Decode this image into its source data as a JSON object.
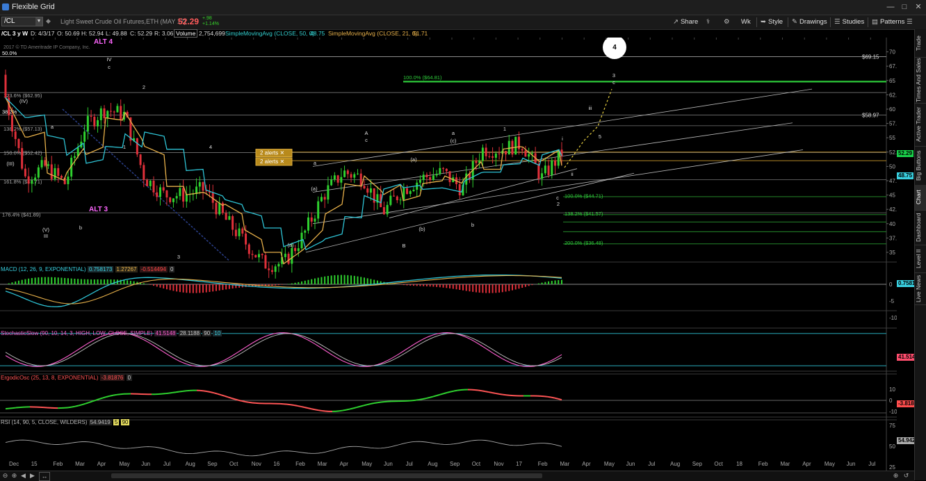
{
  "window": {
    "title": "Flexible Grid"
  },
  "toolbar": {
    "symbol": "/CL",
    "description": "Light Sweet Crude Oil Futures,ETH (MAY 17)",
    "last_price": "52.29",
    "change": "+.98",
    "change_pct": "+1.14%",
    "buttons": [
      "Share",
      "Wk",
      "Style",
      "Drawings",
      "Studies",
      "Patterns"
    ]
  },
  "info": {
    "symbol_period": "/CL 3 y W",
    "date": "D: 4/3/17",
    "open": "O: 50.69",
    "high": "H: 52.94",
    "low": "L: 49.88",
    "close": "C: 52.29",
    "range": "R: 3.06",
    "volume_label": "Volume",
    "volume": "2,754,699",
    "sma50_label": "SimpleMovingAvg (CLOSE, 50, 0)",
    "sma50_value": "48.75",
    "sma21_label": "SimpleMovingAvg (CLOSE, 21, 0)",
    "sma21_value": "51.71",
    "copyright": "2017 © TD Ameritrade IP Company, Inc."
  },
  "price_axis": [
    "70",
    "67.5",
    "65",
    "62.5",
    "60",
    "57.5",
    "55",
    "52.5",
    "50",
    "47.5",
    "45",
    "42.5",
    "40",
    "37.5",
    "35"
  ],
  "price_flags": {
    "last": "52.29",
    "sma50": "48.75",
    "hi_level": "$69.15",
    "level2": "$58.97"
  },
  "fib_labels": {
    "left": [
      "50.0%",
      "123.6% ($62.95)",
      "38.2%",
      "138.2% ($57.13)",
      "150.0% ($52.42)",
      "161.8% ($47.71)",
      "176.4% ($41.89)"
    ],
    "right": [
      "100.0% ($64.81)",
      "100.0% ($44.71)",
      "138.2% ($41.57)",
      "200.0% ($36.48)"
    ]
  },
  "alerts": [
    "2 alerts",
    "2 alerts"
  ],
  "wave_labels": {
    "alt4": "ALT 4",
    "alt3": "ALT 3",
    "circle4": "4",
    "items": [
      "IV",
      "c",
      "2",
      "(IV)",
      "a",
      "(III)",
      "1",
      "4",
      "(V)",
      "III",
      "b",
      "3",
      "(a)",
      "a",
      "(a)",
      "A",
      "c",
      "(a)",
      "a",
      "(c)",
      "1",
      "(b)",
      "B",
      "b",
      "i",
      "c",
      "2",
      "ii",
      "iii",
      "3",
      "c",
      "5",
      "4"
    ]
  },
  "macd": {
    "label": "MACD (12, 26, 9, EXPONENTIAL)",
    "v1": "0.758173",
    "v2": "1.27267",
    "v3": "-0.514494",
    "v4": "0",
    "flag": "0.75817",
    "axis": [
      "0",
      "-5",
      "-10"
    ]
  },
  "stoch": {
    "label": "StochasticSlow (90, 10, 14, 3, HIGH, LOW, CLOSE, SIMPLE)",
    "v1": "41.5148",
    "v2": "28.1188",
    "v3": "90",
    "v4": "10",
    "flag": "41.5148"
  },
  "ergodic": {
    "label": "ErgodicOsc (25, 13, 8, EXPONENTIAL)",
    "v1": "-3.81876",
    "v2": "0",
    "flag": "-3.8188",
    "axis": [
      "10",
      "0",
      "-10"
    ]
  },
  "rsi": {
    "label": "RSI (14, 90, 5, CLOSE, WILDERS)",
    "v1": "54.9419",
    "v2": "5",
    "v3": "90",
    "flag": "54.942",
    "axis": [
      "75",
      "50",
      "25"
    ]
  },
  "time_axis": [
    "Dec",
    "15",
    "Feb",
    "Mar",
    "Apr",
    "May",
    "Jun",
    "Jul",
    "Aug",
    "Sep",
    "Oct",
    "Nov",
    "16",
    "Feb",
    "Mar",
    "Apr",
    "May",
    "Jun",
    "Jul",
    "Aug",
    "Sep",
    "Oct",
    "Nov",
    "17",
    "Feb",
    "Mar",
    "Apr",
    "May",
    "Jun",
    "Jul",
    "Aug",
    "Sep",
    "Oct",
    "18",
    "Feb",
    "Mar",
    "Apr",
    "May",
    "Jun",
    "Jul"
  ],
  "sidebar": [
    "Trade",
    "Times And Sales",
    "Active Trader",
    "Big Buttons",
    "Chart",
    "Dashboard",
    "Level II",
    "Live News"
  ],
  "chart_data": {
    "type": "candlestick",
    "title": "/CL 3 y W",
    "ylim": [
      33,
      72
    ],
    "weekly_close_approx": [
      {
        "x": "Dec 14",
        "y": 62
      },
      {
        "x": "Jan 15",
        "y": 48
      },
      {
        "x": "Feb 15",
        "y": 50
      },
      {
        "x": "Mar 15",
        "y": 47
      },
      {
        "x": "Apr 15",
        "y": 57
      },
      {
        "x": "May 15",
        "y": 60
      },
      {
        "x": "Jun 15",
        "y": 59
      },
      {
        "x": "Jul 15",
        "y": 48
      },
      {
        "x": "Aug 15",
        "y": 45
      },
      {
        "x": "Sep 15",
        "y": 45
      },
      {
        "x": "Oct 15",
        "y": 46
      },
      {
        "x": "Nov 15",
        "y": 41
      },
      {
        "x": "Dec 15",
        "y": 37
      },
      {
        "x": "Jan 16",
        "y": 33
      },
      {
        "x": "Feb 16",
        "y": 33
      },
      {
        "x": "Mar 16",
        "y": 38
      },
      {
        "x": "Apr 16",
        "y": 45
      },
      {
        "x": "May 16",
        "y": 49
      },
      {
        "x": "Jun 16",
        "y": 48
      },
      {
        "x": "Jul 16",
        "y": 42
      },
      {
        "x": "Aug 16",
        "y": 46
      },
      {
        "x": "Sep 16",
        "y": 48
      },
      {
        "x": "Oct 16",
        "y": 49
      },
      {
        "x": "Nov 16",
        "y": 46
      },
      {
        "x": "Dec 16",
        "y": 53
      },
      {
        "x": "Jan 17",
        "y": 53
      },
      {
        "x": "Feb 17",
        "y": 54
      },
      {
        "x": "Mar 17",
        "y": 48
      },
      {
        "x": "Apr 17",
        "y": 52.29
      }
    ]
  }
}
